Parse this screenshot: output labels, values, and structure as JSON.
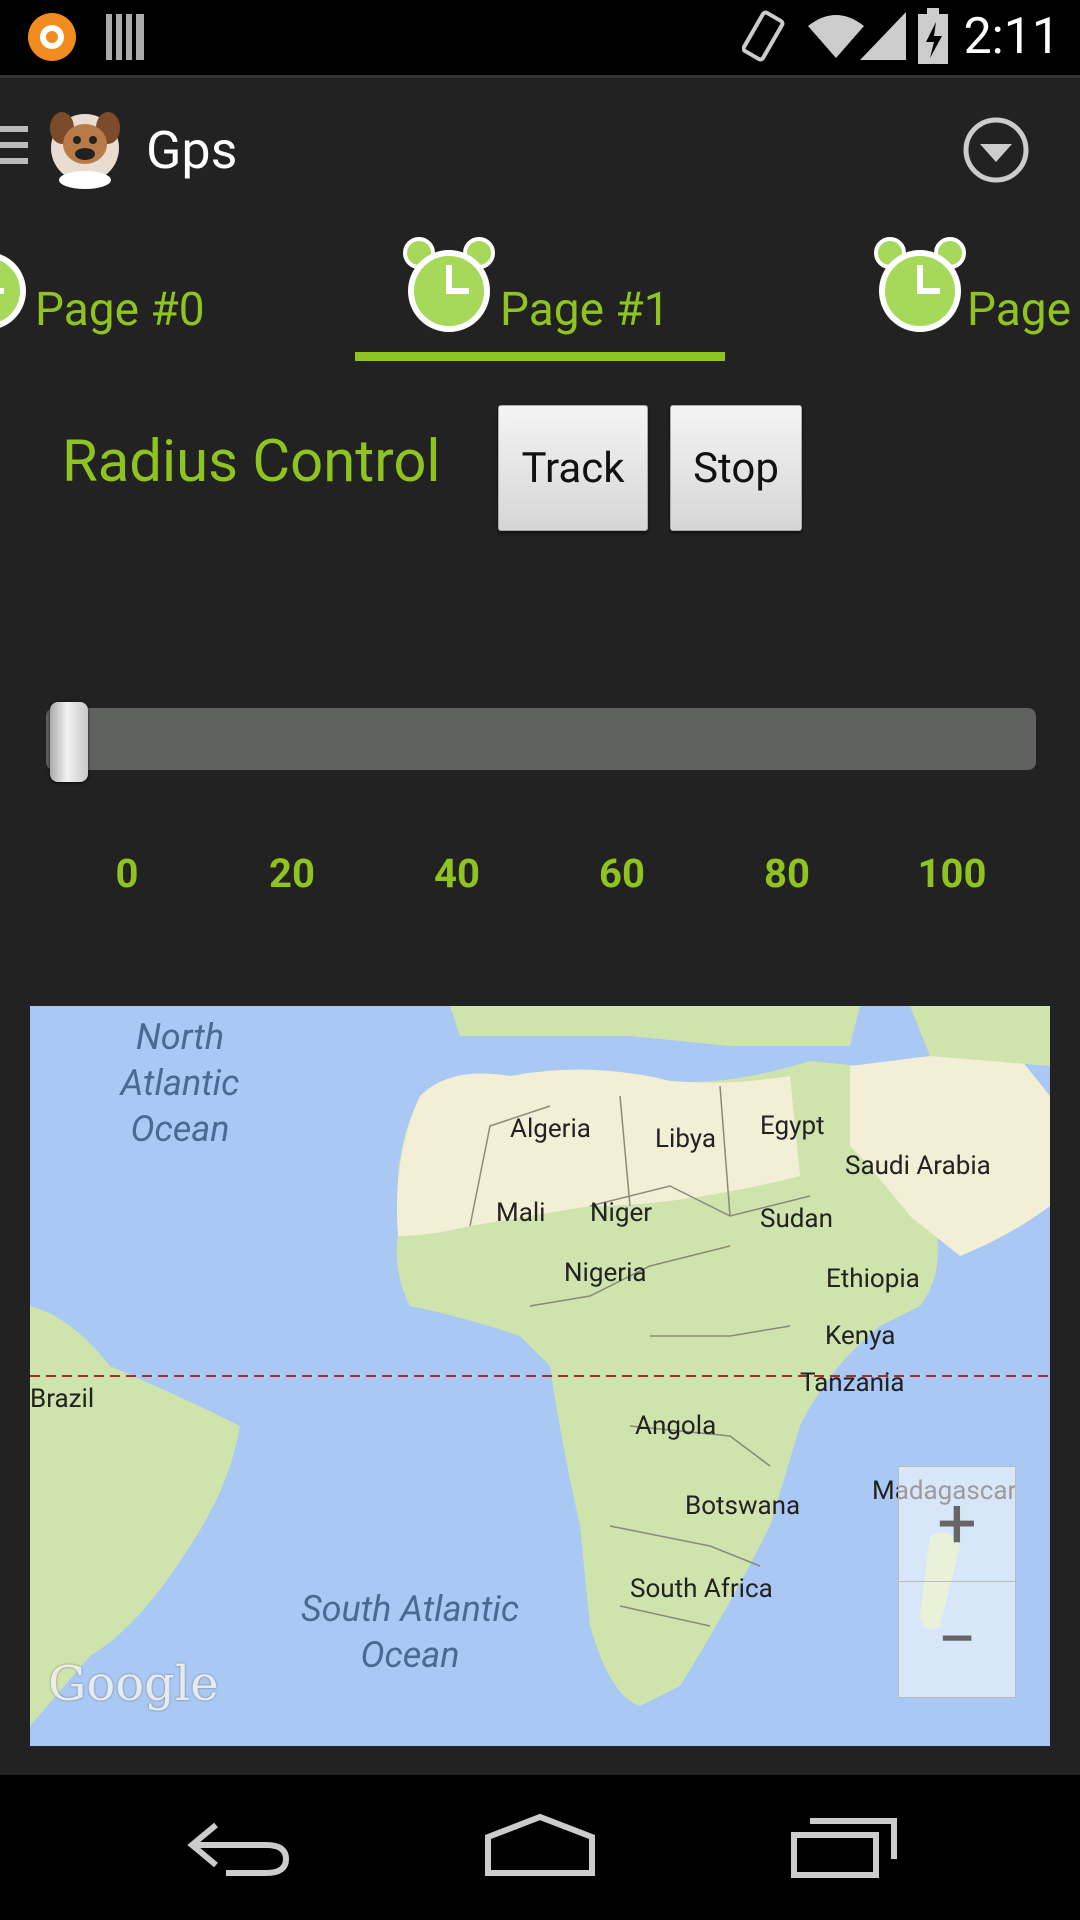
{
  "status_bar": {
    "time": "2:11",
    "icons": [
      "app-icon",
      "barcode-icon",
      "vibrate-icon",
      "wifi-icon",
      "signal-icon",
      "battery-icon"
    ]
  },
  "action_bar": {
    "title": "Gps",
    "icons": [
      "menu-icon",
      "bulldog-icon",
      "dropdown-icon"
    ]
  },
  "tabs": [
    {
      "label": "Page #0",
      "icon": "alarm-clock-icon",
      "selected": false
    },
    {
      "label": "Page #1",
      "icon": "alarm-clock-icon",
      "selected": true
    },
    {
      "label": "Page",
      "icon": "alarm-clock-icon",
      "selected": false
    }
  ],
  "controls": {
    "radius_title": "Radius Control",
    "track_label": "Track",
    "stop_label": "Stop"
  },
  "slider": {
    "value": 0,
    "ticks": [
      "0",
      "20",
      "40",
      "60",
      "80",
      "100"
    ]
  },
  "map": {
    "labels": {
      "algeria": "Algeria",
      "libya": "Libya",
      "egypt": "Egypt",
      "saudi": "Saudi Arabia",
      "mali": "Mali",
      "niger": "Niger",
      "sudan": "Sudan",
      "nigeria": "Nigeria",
      "ethiopia": "Ethiopia",
      "kenya": "Kenya",
      "brazil": "Brazil",
      "tanzania": "Tanzania",
      "angola": "Angola",
      "madagascar": "Madagascar",
      "botswana": "Botswana",
      "south_africa": "South Africa"
    },
    "ocean_north_1": "North Atlantic",
    "ocean_north_2": "Ocean",
    "ocean_south_1": "South Atlantic",
    "ocean_south_2": "Ocean",
    "zoom_in": "+",
    "zoom_out": "−",
    "logo": "Google"
  },
  "colors": {
    "accent": "#8fc31f",
    "background": "#222222",
    "water": "#a9c8f3",
    "land": "#f3efd6",
    "land_green": "#cfe3ac"
  }
}
